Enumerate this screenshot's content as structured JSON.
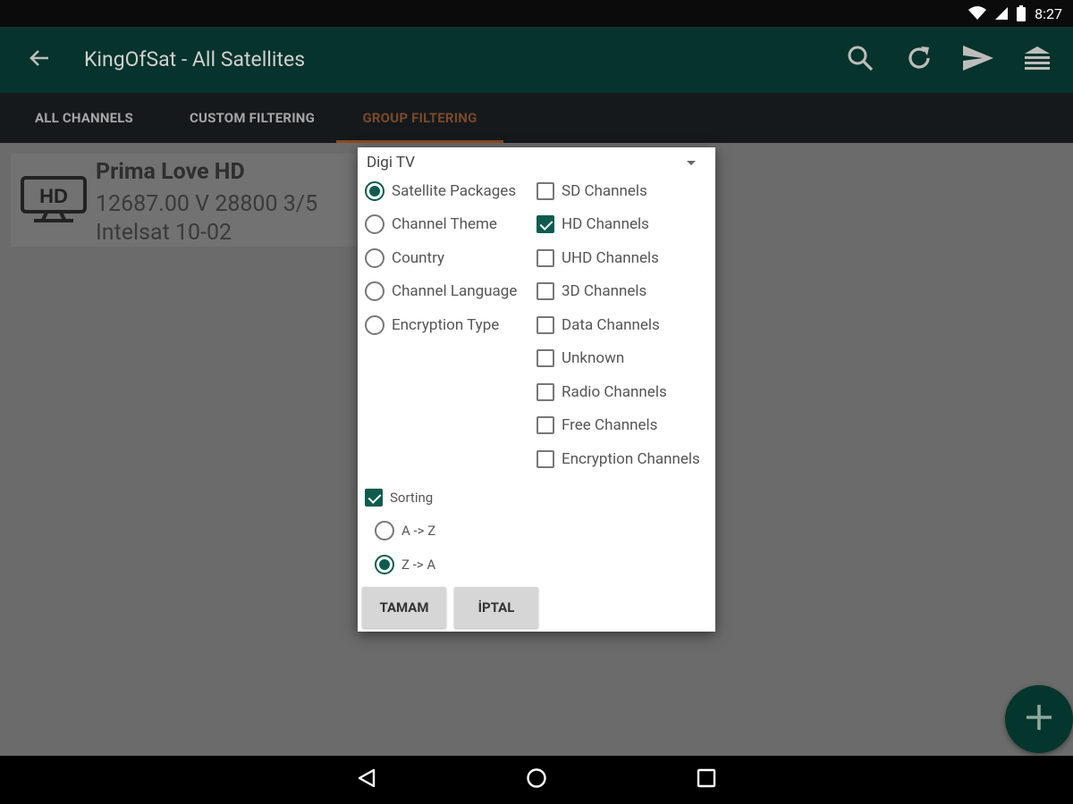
{
  "status_bar": {
    "time": "8:27"
  },
  "app_bar": {
    "title": "KingOfSat - All Satellites"
  },
  "tabs": [
    {
      "label": "ALL CHANNELS"
    },
    {
      "label": "CUSTOM FILTERING"
    },
    {
      "label": "GROUP FILTERING"
    }
  ],
  "channel": {
    "icon_text": "HD",
    "name": "Prima Love HD",
    "frequency": "12687.00 V 28800 3/5",
    "satellite": "Intelsat 10-02"
  },
  "dialog": {
    "dropdown_value": "Digi TV",
    "radios": [
      {
        "label": "Satellite Packages",
        "selected": true
      },
      {
        "label": "Channel Theme",
        "selected": false
      },
      {
        "label": "Country",
        "selected": false
      },
      {
        "label": "Channel Language",
        "selected": false
      },
      {
        "label": "Encryption Type",
        "selected": false
      }
    ],
    "checks": [
      {
        "label": "SD Channels",
        "checked": false
      },
      {
        "label": "HD Channels",
        "checked": true
      },
      {
        "label": "UHD Channels",
        "checked": false
      },
      {
        "label": "3D Channels",
        "checked": false
      },
      {
        "label": "Data Channels",
        "checked": false
      },
      {
        "label": "Unknown",
        "checked": false
      },
      {
        "label": "Radio Channels",
        "checked": false
      },
      {
        "label": "Free Channels",
        "checked": false
      },
      {
        "label": "Encryption Channels",
        "checked": false
      }
    ],
    "sorting": {
      "label": "Sorting",
      "checked": true
    },
    "sort_options": [
      {
        "label": "A -> Z",
        "selected": false
      },
      {
        "label": "Z -> A",
        "selected": true
      }
    ],
    "ok_label": "TAMAM",
    "cancel_label": "İPTAL"
  },
  "colors": {
    "app_bar": "#06332b",
    "accent": "#0e5c4f",
    "active_tab": "#8b4a22"
  },
  "icons": [
    "back-arrow-icon",
    "search-icon",
    "refresh-icon",
    "send-icon",
    "menu-icon",
    "hd-tv-icon",
    "plus-icon",
    "nav-back-icon",
    "nav-home-icon",
    "nav-recents-icon",
    "wifi-icon",
    "signal-icon",
    "battery-icon"
  ]
}
